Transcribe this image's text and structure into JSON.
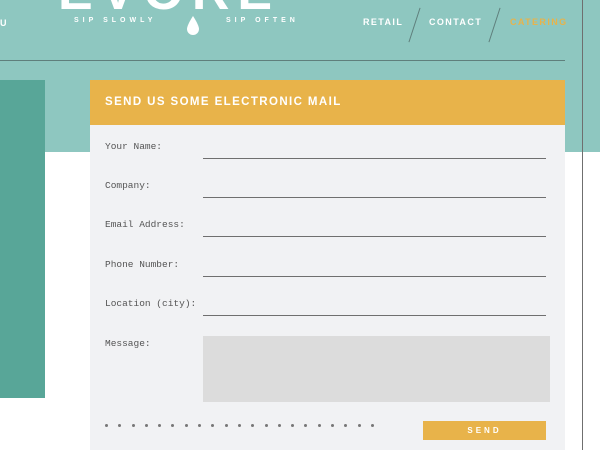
{
  "header": {
    "logo_text": "EVORE",
    "tagline_left": "SIP SLOWLY",
    "tagline_right": "SIP OFTEN",
    "nav_cut_label": "U",
    "nav": {
      "retail": "RETAIL",
      "contact": "CONTACT",
      "catering": "CATERING"
    }
  },
  "form": {
    "title": "SEND US SOME ELECTRONIC MAIL",
    "fields": {
      "name_label": "Your Name:",
      "company_label": "Company:",
      "email_label": "Email Address:",
      "phone_label": "Phone Number:",
      "location_label": "Location (city):",
      "message_label": "Message:"
    },
    "send_label": "SEND"
  },
  "colors": {
    "header_teal": "#8ec7c0",
    "side_teal": "#58a698",
    "accent_gold": "#e8b34a",
    "card_bg": "#f1f2f4"
  }
}
